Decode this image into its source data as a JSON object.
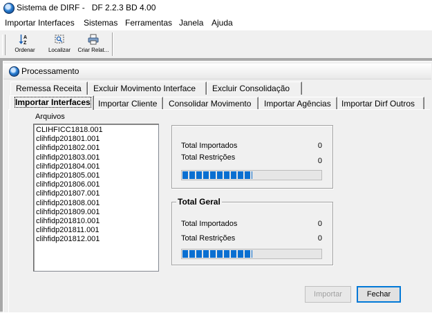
{
  "window": {
    "title": "Sistema de DIRF -   DF 2.2.3 BD 4.00"
  },
  "menu": [
    "Importar Interfaces",
    "Sistemas",
    "Ferramentas",
    "Janela",
    "Ajuda"
  ],
  "toolbar": {
    "buttons": [
      {
        "label": "Ordenar",
        "icon": "sort-az-icon"
      },
      {
        "label": "Localizar",
        "icon": "find-icon"
      },
      {
        "label": "Criar Relat...",
        "icon": "printer-icon"
      }
    ]
  },
  "child": {
    "title": "Processamento",
    "tabs_row1": [
      "Remessa Receita",
      "Excluir  Movimento Interface",
      "Excluir  Consolidação"
    ],
    "tabs_row2": [
      "Importar Interfaces",
      "Importar Cliente",
      "Consolidar Movimento",
      "Importar Agências",
      "Importar Dirf Outros"
    ],
    "active_tab": "Importar Interfaces",
    "files_label": "Arquivos",
    "files": [
      "CLIHFICC1818.001",
      "clihfidp201801.001",
      "clihfidp201802.001",
      "clihfidp201803.001",
      "clihfidp201804.001",
      "clihfidp201805.001",
      "clihfidp201806.001",
      "clihfidp201807.001",
      "clihfidp201808.001",
      "clihfidp201809.001",
      "clihfidp201810.001",
      "clihfidp201811.001",
      "clihfidp201812.001"
    ],
    "current": {
      "imported_label": "Total Importados",
      "imported_value": "0",
      "restrictions_label": "Total Restrições",
      "restrictions_value": "0",
      "progress": 0.5
    },
    "total": {
      "title": "Total Geral",
      "imported_label": "Total Importados",
      "imported_value": "0",
      "restrictions_label": "Total Restrições",
      "restrictions_value": "0",
      "progress": 0.5
    },
    "buttons": {
      "import": "Importar",
      "close": "Fechar"
    }
  },
  "colors": {
    "progress": "#0a6fd1",
    "mdi_background": "#a8a8a8"
  }
}
